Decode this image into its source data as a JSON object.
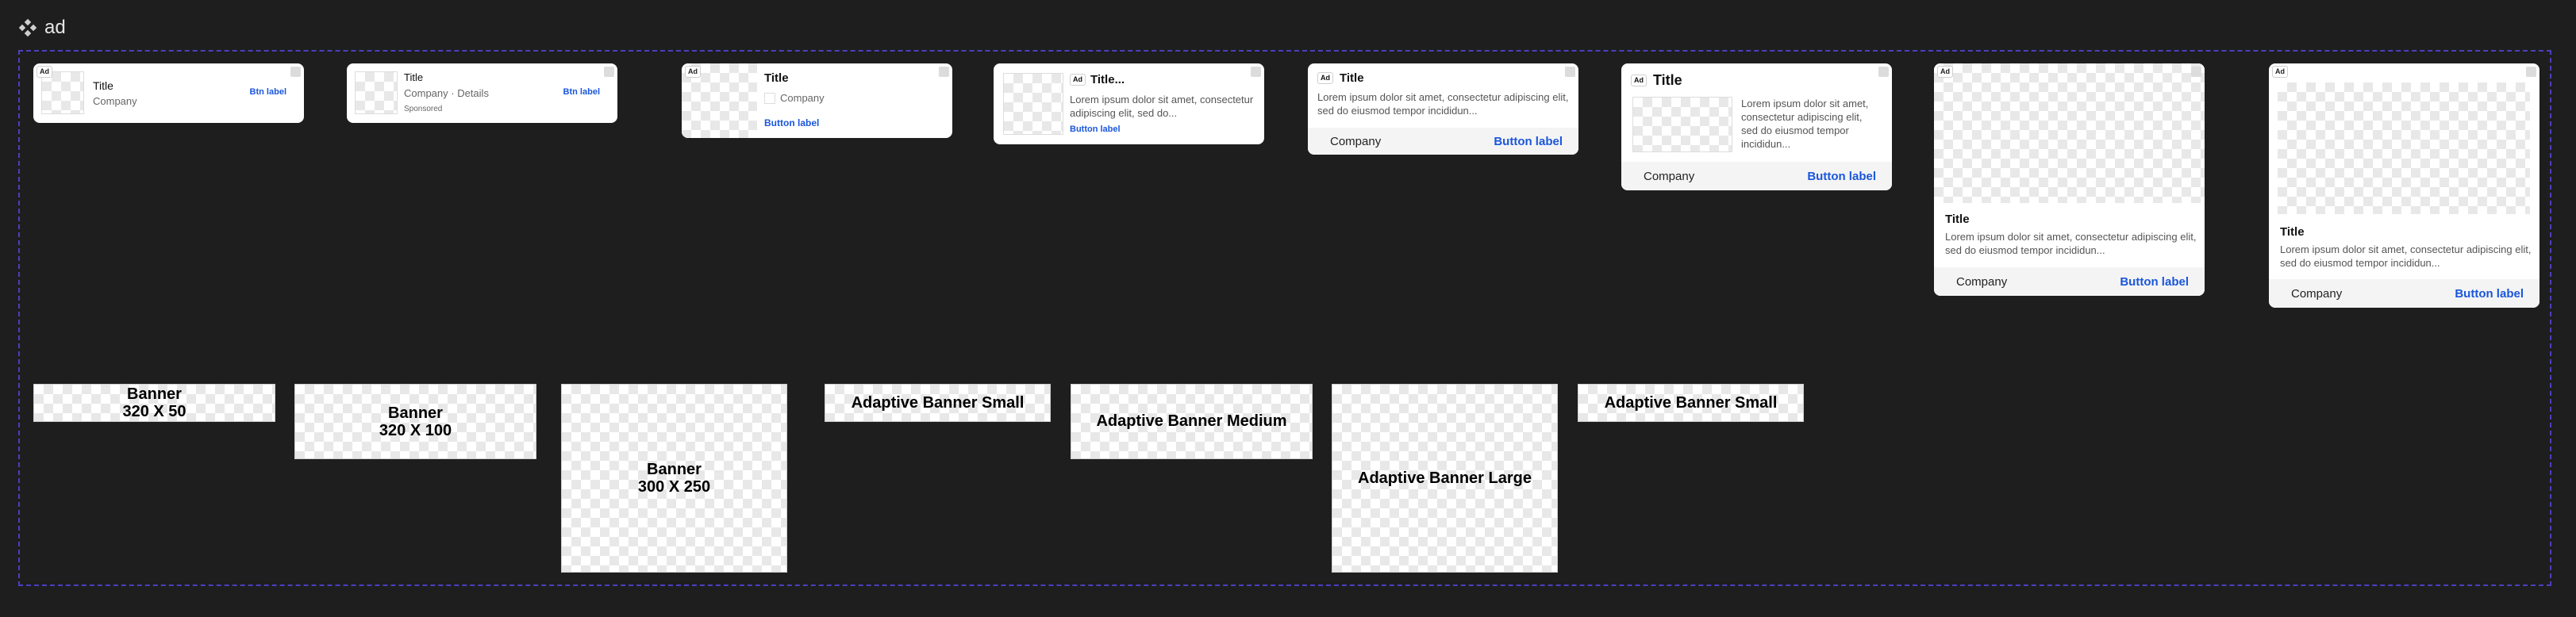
{
  "canvas": {
    "frame_name": "ad"
  },
  "colors": {
    "background": "#1e1e1e",
    "frame_border": "#4b3fc0",
    "accent": "#1a56db"
  },
  "icons": {
    "component": "component-icon",
    "more": "more-icon"
  },
  "native": {
    "ad_badge": "Ad",
    "small1": {
      "title": "Title",
      "company": "Company",
      "button": "Btn label"
    },
    "small2": {
      "title": "Title",
      "company": "Company",
      "details": "· Details",
      "sponsored": "Sponsored",
      "button": "Btn label"
    },
    "medium1": {
      "title": "Title",
      "company": "Company",
      "button": "Button label"
    },
    "medium2": {
      "title": "Title...",
      "body": "Lorem ipsum dolor sit amet, consectetur adipiscing elit, sed do...",
      "button": "Button label"
    },
    "medium3": {
      "title": "Title",
      "body": "Lorem ipsum dolor sit amet, consectetur adipiscing elit, sed do eiusmod tempor incididun...",
      "company": "Company",
      "button": "Button label"
    },
    "large1": {
      "title": "Title",
      "body": "Lorem ipsum dolor sit amet, consectetur adipiscing elit, sed do eiusmod tempor incididun...",
      "company": "Company",
      "button": "Button label"
    },
    "xl1": {
      "title": "Title",
      "body": "Lorem ipsum dolor sit amet, consectetur adipiscing elit, sed do eiusmod tempor incididun...",
      "company": "Company",
      "button": "Button label"
    },
    "xl2": {
      "title": "Title",
      "body": "Lorem ipsum dolor sit amet, consectetur adipiscing elit, sed do eiusmod tempor incididun...",
      "company": "Company",
      "button": "Button label"
    }
  },
  "banners": {
    "b320x50": {
      "line1": "Banner",
      "line2": "320 X 50"
    },
    "b320x100": {
      "line1": "Banner",
      "line2": "320 X 100"
    },
    "b300x250": {
      "line1": "Banner",
      "line2": "300 X 250"
    },
    "adaptive_small": "Adaptive Banner Small",
    "adaptive_medium": "Adaptive Banner Medium",
    "adaptive_large": "Adaptive Banner Large",
    "adaptive_small2": "Adaptive Banner Small"
  }
}
